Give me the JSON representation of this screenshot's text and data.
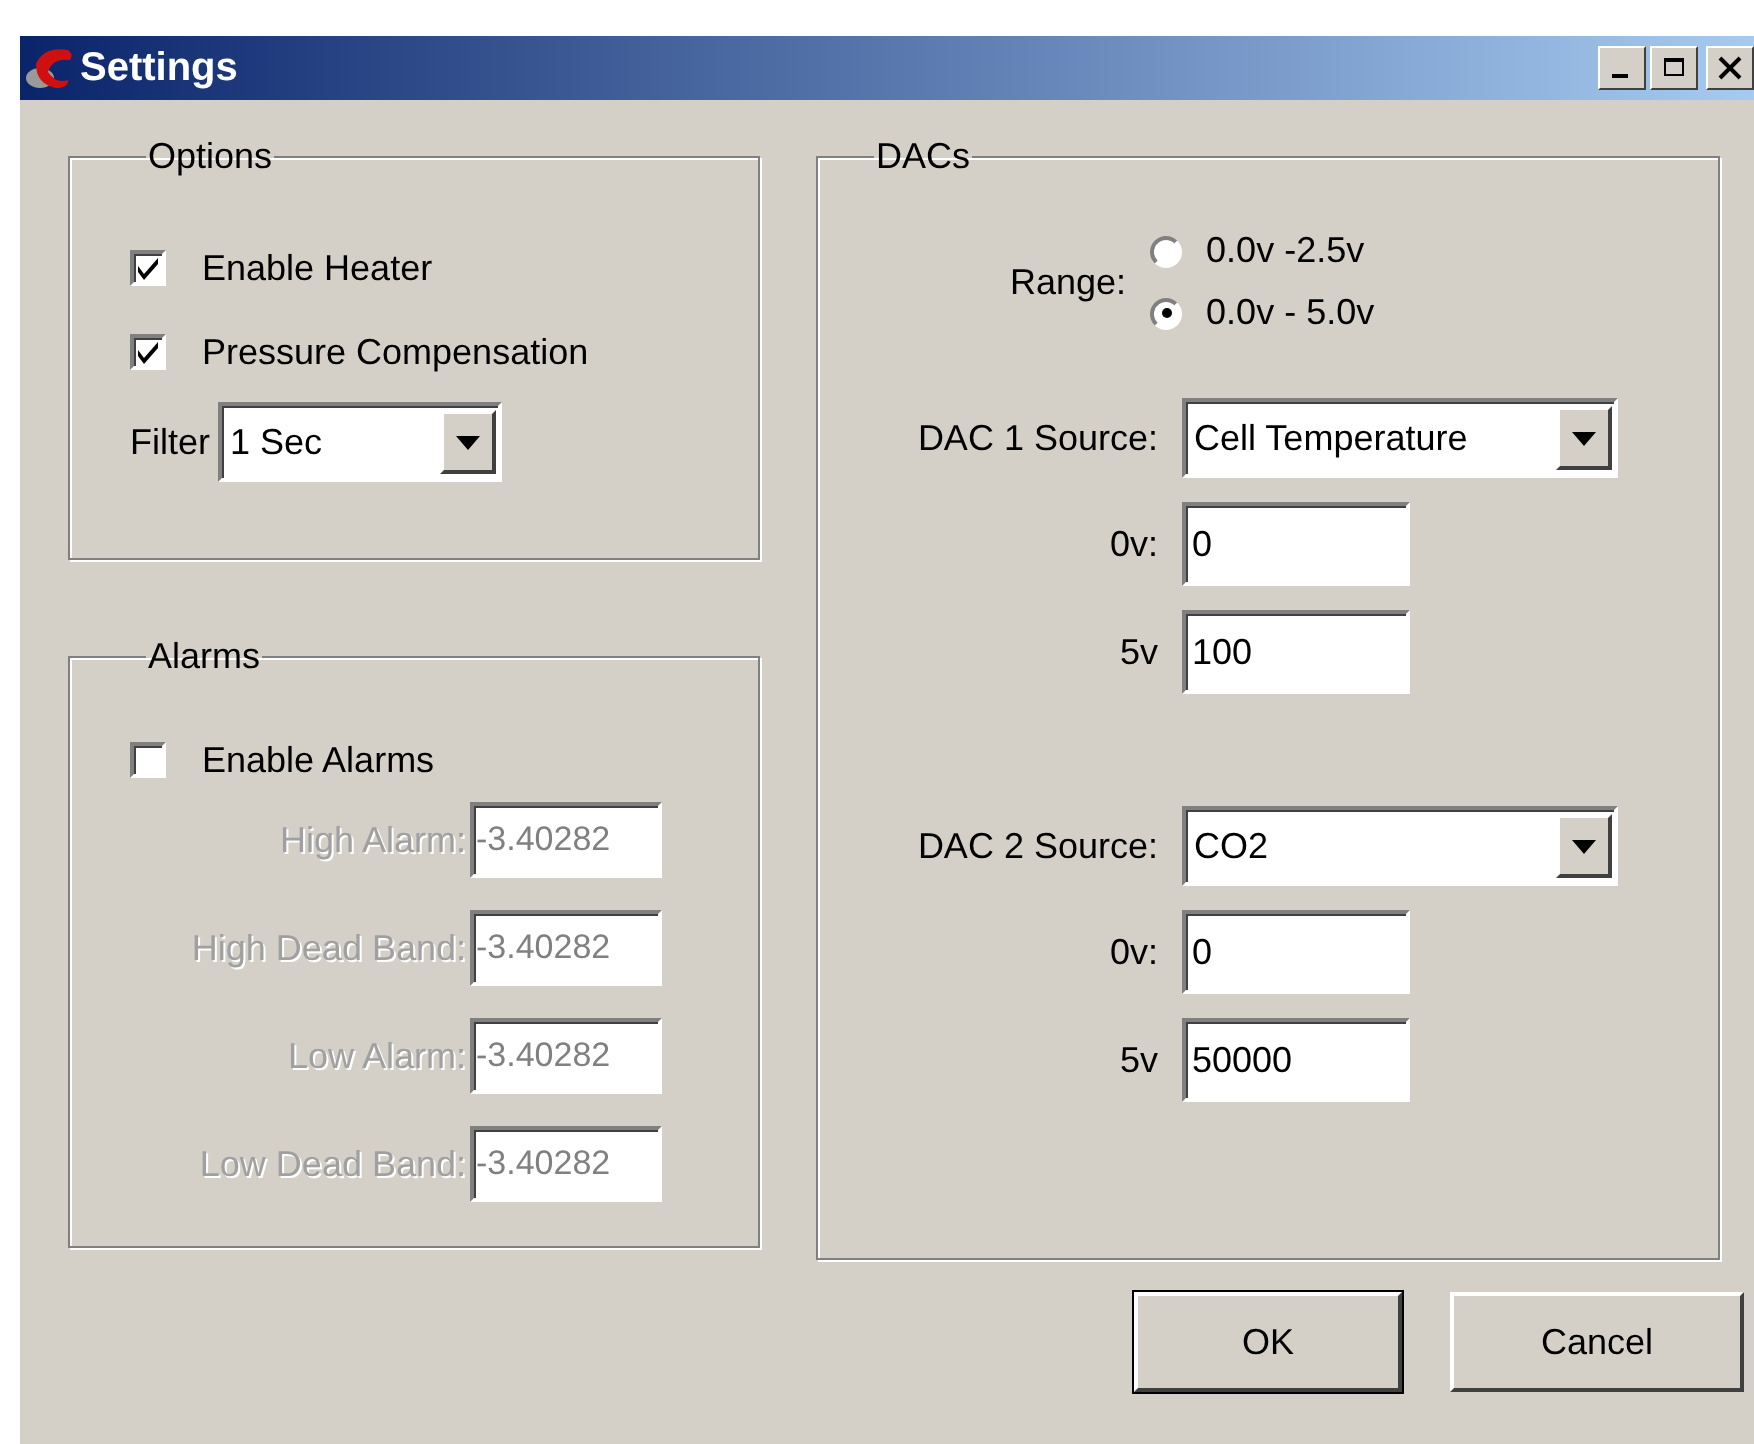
{
  "window": {
    "title": "Settings"
  },
  "options": {
    "title": "Options",
    "checkboxes": [
      {
        "label": "Enable Heater",
        "checked": true
      },
      {
        "label": "Pressure Compensation",
        "checked": true
      }
    ],
    "filter": {
      "label": "Filter",
      "value": "1 Sec"
    }
  },
  "alarms": {
    "title": "Alarms",
    "enable": {
      "label": "Enable Alarms",
      "checked": false
    },
    "fields": [
      {
        "label": "High Alarm:",
        "value": "-3.40282",
        "disabled": true
      },
      {
        "label": "High Dead Band:",
        "value": "-3.40282",
        "disabled": true
      },
      {
        "label": "Low Alarm:",
        "value": "-3.40282",
        "disabled": true
      },
      {
        "label": "Low Dead Band:",
        "value": "-3.40282",
        "disabled": true
      }
    ]
  },
  "dacs": {
    "title": "DACs",
    "range": {
      "label": "Range:",
      "options": [
        {
          "label": "0.0v -2.5v",
          "selected": false
        },
        {
          "label": "0.0v - 5.0v",
          "selected": true
        }
      ]
    },
    "sources": [
      {
        "label": "DAC 1 Source:",
        "value": "Cell Temperature",
        "zero": {
          "label": "0v:",
          "value": "0"
        },
        "full": {
          "label": "5v",
          "value": "100"
        }
      },
      {
        "label": "DAC 2 Source:",
        "value": "CO2",
        "zero": {
          "label": "0v:",
          "value": "0"
        },
        "full": {
          "label": "5v",
          "value": "50000"
        }
      }
    ]
  },
  "buttons": [
    {
      "label": "OK",
      "default": true
    },
    {
      "label": "Cancel",
      "default": false
    }
  ]
}
